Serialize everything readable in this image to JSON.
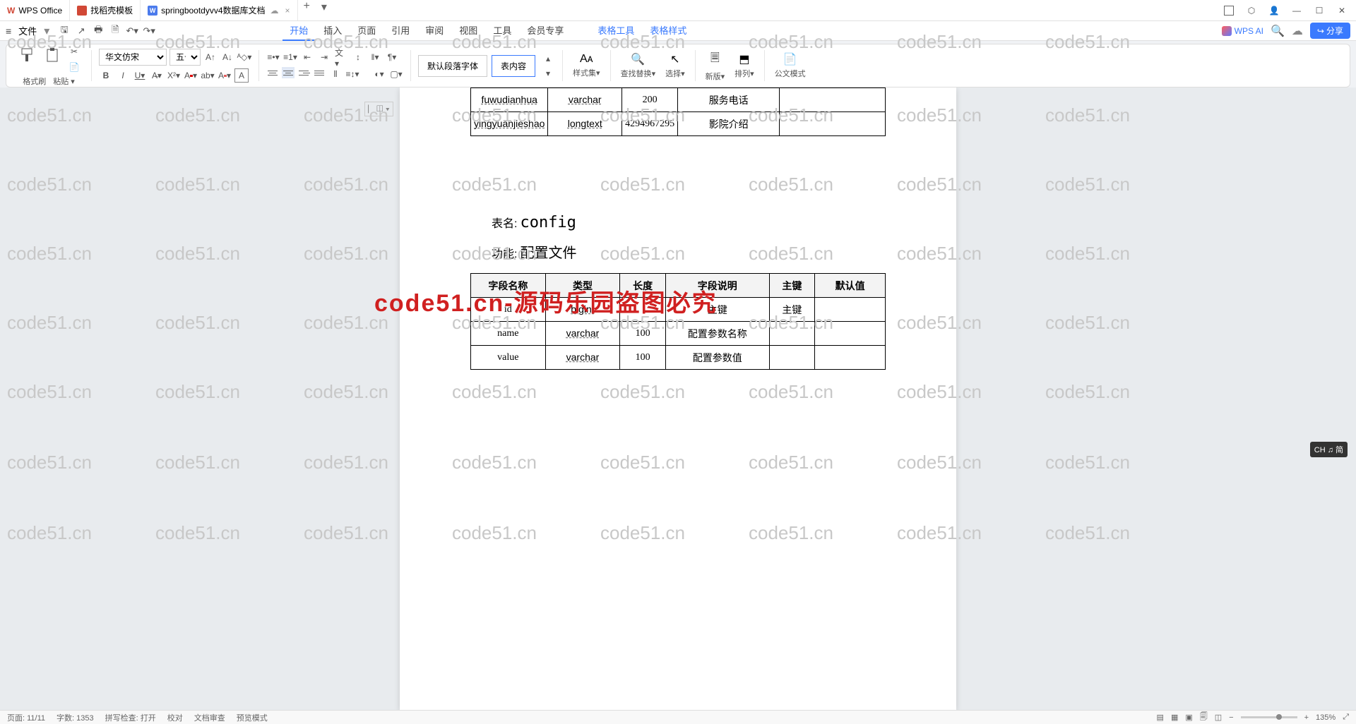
{
  "app": {
    "name": "WPS Office"
  },
  "tabs": [
    {
      "label": "找稻壳模板",
      "icon": "red"
    },
    {
      "label": "springbootdyvv4数据库文档",
      "icon": "blue-w",
      "active": true
    }
  ],
  "tab_close": "×",
  "tab_add": "+",
  "menu": {
    "file": "文件",
    "items": [
      "开始",
      "插入",
      "页面",
      "引用",
      "审阅",
      "视图",
      "工具",
      "会员专享"
    ],
    "active_index": 0,
    "tool_tabs": [
      "表格工具",
      "表格样式"
    ],
    "wps_ai": "WPS AI",
    "share": "分享"
  },
  "ribbon": {
    "format_brush": "格式刷",
    "paste": "粘贴",
    "font_name": "华文仿宋",
    "font_size": "五号",
    "style_default": "默认段落字体",
    "style_content": "表内容",
    "styles_label": "样式集",
    "find_replace": "查找替换",
    "select": "选择",
    "section": "新版",
    "arrange": "排列",
    "doc_mode": "公文模式"
  },
  "document": {
    "table1": {
      "rows": [
        {
          "c1": "fuwudianhua",
          "c2": "varchar",
          "c3": "200",
          "c4": "服务电话",
          "c5": ""
        },
        {
          "c1": "yingyuanjieshao",
          "c2": "longtext",
          "c3": "4294967295",
          "c4": "影院介绍",
          "c5": ""
        }
      ]
    },
    "section2": {
      "title_label": "表名:",
      "title_value": "config",
      "func_label": "功能:",
      "func_value": "配置文件"
    },
    "table2": {
      "headers": [
        "字段名称",
        "类型",
        "长度",
        "字段说明",
        "主键",
        "默认值"
      ],
      "rows": [
        {
          "c1": "id",
          "c2": "bigint",
          "c3": "",
          "c4": "主键",
          "c5": "主键",
          "c6": ""
        },
        {
          "c1": "name",
          "c2": "varchar",
          "c3": "100",
          "c4": "配置参数名称",
          "c5": "",
          "c6": ""
        },
        {
          "c1": "value",
          "c2": "varchar",
          "c3": "100",
          "c4": "配置参数值",
          "c5": "",
          "c6": ""
        }
      ]
    }
  },
  "watermark_text": "code51.cn",
  "big_watermark": "code51.cn-源码乐园盗图必究",
  "ime": "CH ♫ 简",
  "statusbar": {
    "page": "页面: 11/11",
    "words": "字数: 1353",
    "spell": "拼写检查: 打开",
    "corr": "校对",
    "comp": "文档审查",
    "mode": "预览模式",
    "zoom": "135%"
  }
}
